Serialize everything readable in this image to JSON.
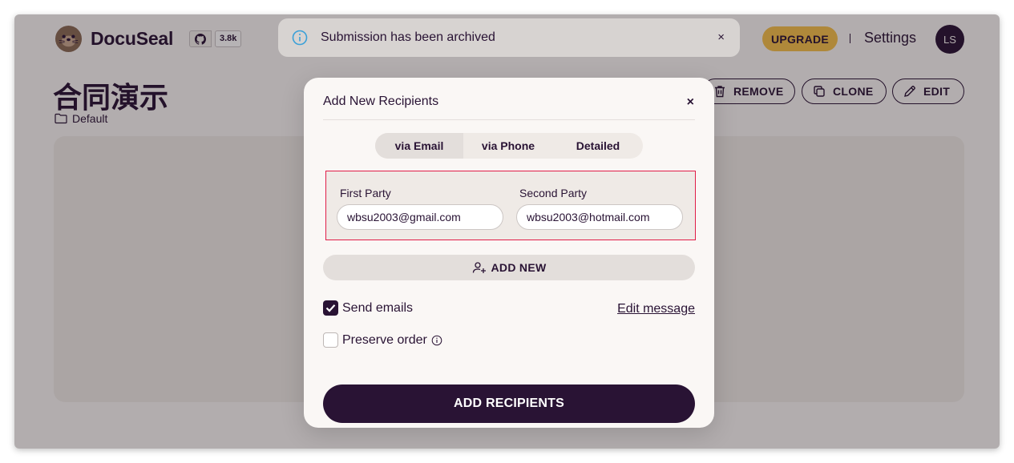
{
  "header": {
    "app_name": "DocuSeal",
    "github_stars": "3.8k",
    "upgrade_label": "UPGRADE",
    "settings_label": "Settings",
    "avatar_initials": "LS"
  },
  "toast": {
    "message": "Submission has been archived",
    "close": "×"
  },
  "template": {
    "title": "合同演示",
    "folder": "Default",
    "actions": {
      "remove": "REMOVE",
      "clone": "CLONE",
      "edit": "EDIT"
    }
  },
  "modal": {
    "title": "Add New Recipients",
    "close": "×",
    "tabs": [
      {
        "label": "via Email",
        "active": true
      },
      {
        "label": "via Phone",
        "active": false
      },
      {
        "label": "Detailed",
        "active": false
      }
    ],
    "parties": [
      {
        "label": "First Party",
        "value": "wbsu2003@gmail.com"
      },
      {
        "label": "Second Party",
        "value": "wbsu2003@hotmail.com"
      }
    ],
    "add_new_label": "ADD NEW",
    "send_emails": {
      "label": "Send emails",
      "checked": true
    },
    "edit_message_label": "Edit message",
    "preserve_order": {
      "label": "Preserve order",
      "checked": false
    },
    "submit_label": "ADD RECIPIENTS"
  },
  "colors": {
    "primary": "#291334",
    "accent": "#f5c04a",
    "background": "#faf7f5",
    "highlight_border": "#e11d48"
  }
}
